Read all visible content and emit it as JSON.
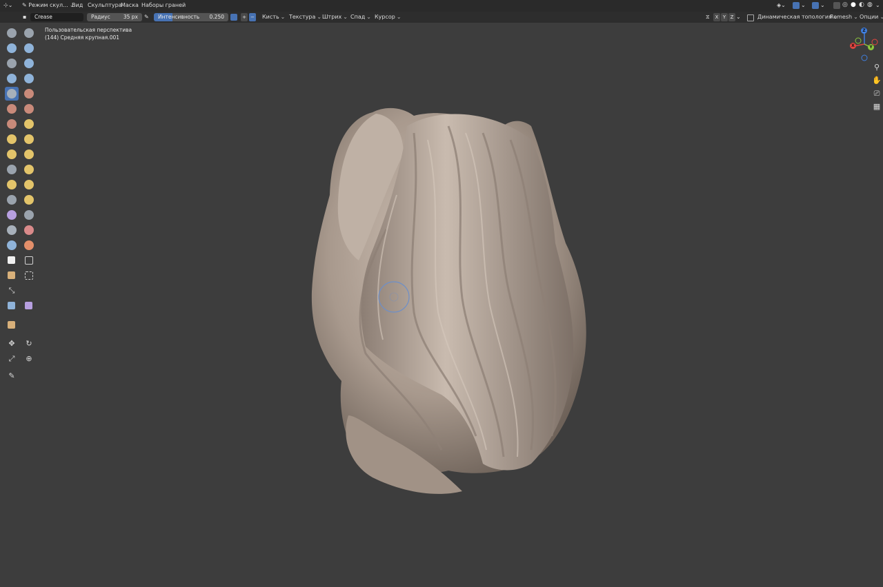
{
  "header": {
    "mode": "Режим скул...",
    "menus": [
      "Вид",
      "Скульптура",
      "Маска",
      "Наборы граней"
    ]
  },
  "tool_header": {
    "brush_name": "Crease",
    "radius_label": "Радиус",
    "radius_value": "35 px",
    "strength_label": "Интенсивность",
    "strength_value": "0.250",
    "strength_fraction": 0.25,
    "menus": [
      "Кисть",
      "Текстура",
      "Штрих",
      "Спад",
      "Курсор"
    ],
    "axes": [
      "X",
      "Y",
      "Z"
    ],
    "dyntopo_label": "Динамическая топология",
    "remesh_label": "Remesh",
    "options_label": "Опции"
  },
  "viewport": {
    "view_name": "Пользовательская перспектива",
    "object_name": "(144) Средняя крупная.001"
  },
  "gizmo": {
    "x": "X",
    "y": "Y",
    "z": "Z"
  },
  "colors": {
    "accent": "#4772b3",
    "axis_x": "#e2453f",
    "axis_y": "#8cc63e",
    "axis_z": "#3f7fe0",
    "mesh": "#b6a79b"
  }
}
